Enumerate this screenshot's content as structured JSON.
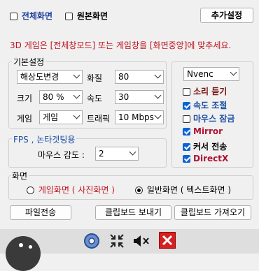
{
  "top": {
    "fullscreen_label": "전체화면",
    "original_label": "원본화면",
    "extra_settings": "추가설정"
  },
  "notice": "3D 게임은 [전체창모드] 또는 게임창을 [화면중앙]에 맞추세요.",
  "basic": {
    "title": "기본설정",
    "resolution_change": "해상도변경",
    "quality_label": "화질",
    "quality_value": "80",
    "size_label": "크기",
    "size_value": "80 %",
    "speed_label": "속도",
    "speed_value": "30",
    "game_label": "게임",
    "game_value": "게임",
    "traffic_label": "트래픽",
    "traffic_value": "10 Mbps"
  },
  "fps": {
    "title": "FPS , 논타겟팅용",
    "mouse_sens_label": "마우스 감도 :",
    "mouse_sens_value": "2"
  },
  "right": {
    "encoder": "Nvenc",
    "options": [
      {
        "label": "소리 듣기",
        "checked": false,
        "color": "#7a1010"
      },
      {
        "label": "속도 조절",
        "checked": true,
        "color": "#1c4fa3"
      },
      {
        "label": "마우스 잠금",
        "checked": false,
        "color": "#1c4fa3"
      },
      {
        "label": "Mirror",
        "checked": true,
        "color": "#b01030"
      },
      {
        "label": "커서 전송",
        "checked": true,
        "color": "#000000"
      },
      {
        "label": "DirectX",
        "checked": true,
        "color": "#b01030"
      }
    ]
  },
  "screen": {
    "title": "화면",
    "game_screen": "게임화면 ( 사진화면 )",
    "normal_screen": "일반화면 ( 텍스트화면 )"
  },
  "buttons": {
    "file_transfer": "파일전송",
    "clipboard_send": "클립보드 보내기",
    "clipboard_get": "클립보드 가져오기"
  },
  "taskbar": {
    "icons": [
      "face-icon",
      "settings-gear-icon",
      "collapse-icon",
      "mute-speaker-icon",
      "close-icon"
    ]
  }
}
